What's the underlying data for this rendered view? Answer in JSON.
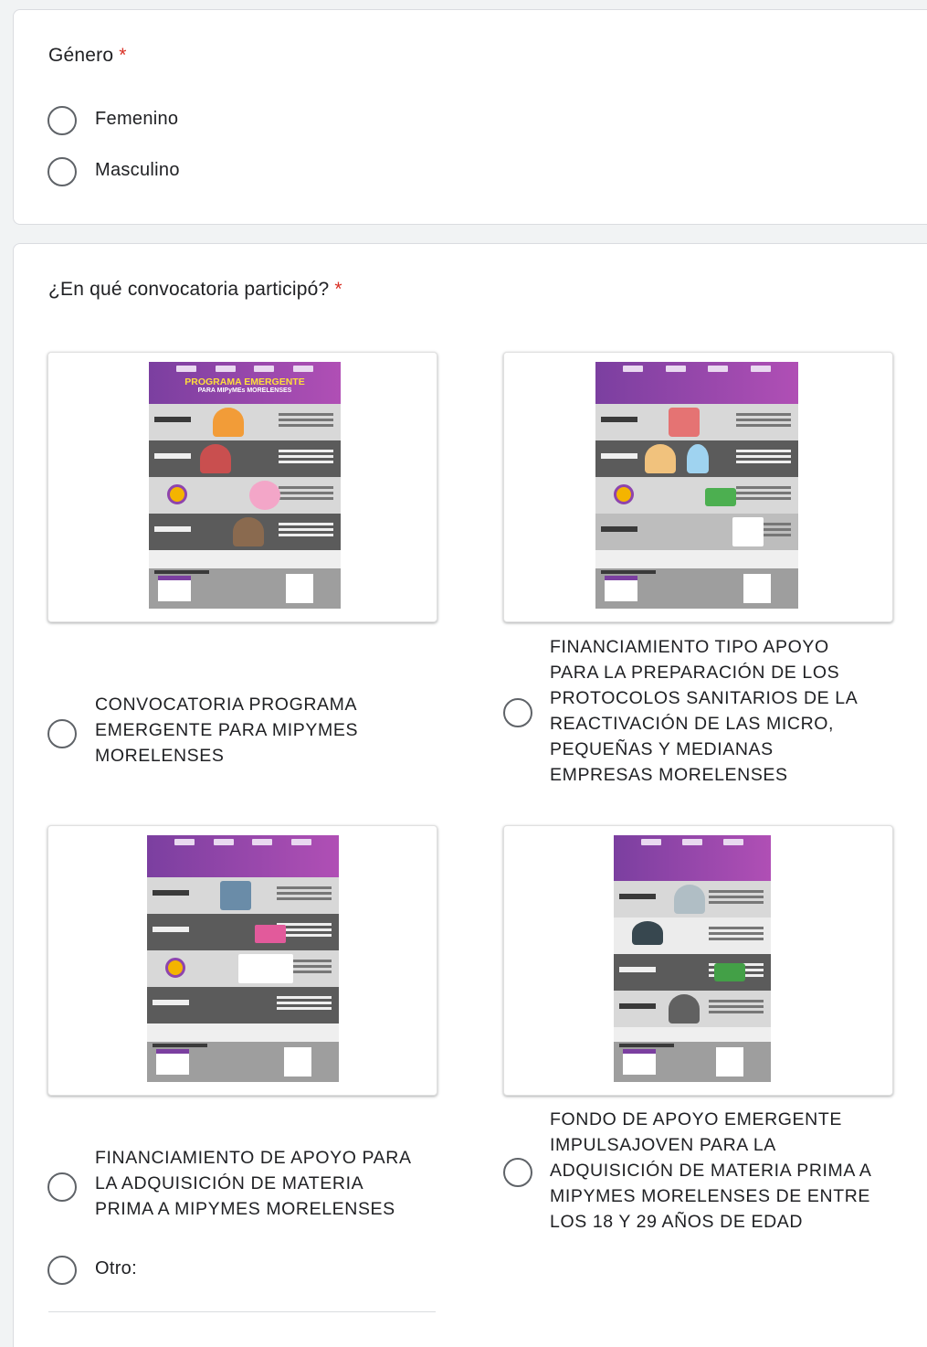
{
  "genero": {
    "title": "Género",
    "required_mark": "*",
    "options": [
      {
        "label": "Femenino",
        "selected": false
      },
      {
        "label": "Masculino",
        "selected": false
      }
    ]
  },
  "convocatoria": {
    "title": "¿En qué convocatoria participó?",
    "required_mark": "*",
    "options": [
      {
        "lines": [
          "CONVOCATORIA PROGRAMA",
          "EMERGENTE PARA MIPYMES",
          "MORELENSES"
        ],
        "poster": {
          "title": "PROGRAMA EMERGENTE",
          "subtitle": "PARA MIPyMEs MORELENSES"
        },
        "selected": false
      },
      {
        "lines": [
          "FINANCIAMIENTO TIPO APOYO",
          "PARA LA PREPARACIÓN DE LOS",
          "PROTOCOLOS SANITARIOS DE LA",
          "REACTIVACIÓN DE LAS MICRO,",
          "PEQUEÑAS Y MEDIANAS",
          "EMPRESAS MORELENSES"
        ],
        "selected": false
      },
      {
        "lines": [
          "FINANCIAMIENTO DE APOYO PARA",
          "LA ADQUISICIÓN DE MATERIA",
          "PRIMA A MIPYMES MORELENSES"
        ],
        "selected": false
      },
      {
        "lines": [
          "FONDO DE APOYO EMERGENTE",
          "IMPULSAJOVEN PARA LA",
          "ADQUISICIÓN DE MATERIA PRIMA A",
          "MIPYMES MORELENSES DE ENTRE",
          "LOS 18 Y 29 AÑOS DE EDAD"
        ],
        "selected": false
      }
    ],
    "other": {
      "label": "Otro:",
      "value": ""
    }
  },
  "colors": {
    "background": "#f1f3f4",
    "card": "#ffffff",
    "required": "#d93025",
    "radio_border": "#5f6368",
    "poster_purple": "#7b3fa0"
  }
}
